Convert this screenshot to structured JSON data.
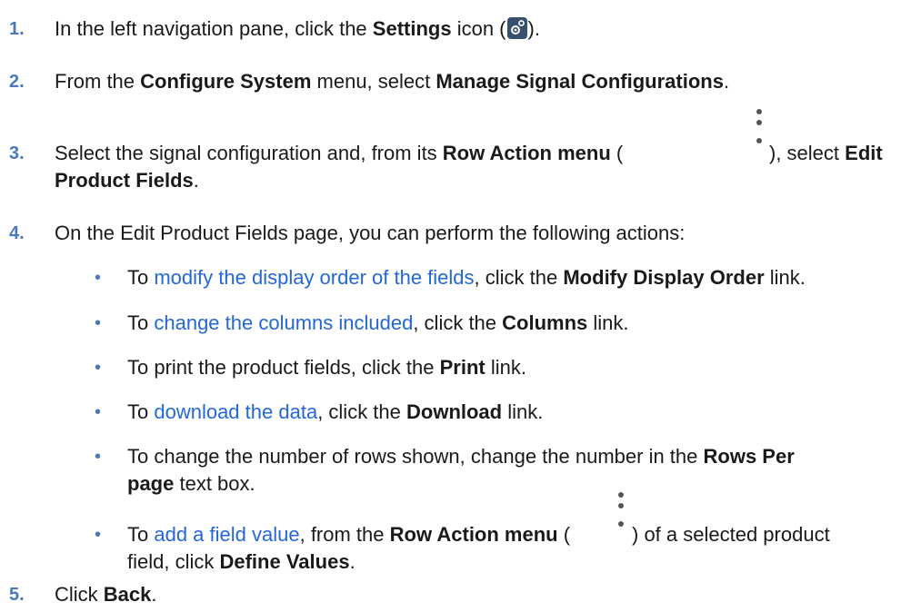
{
  "steps": [
    {
      "number": "1.",
      "before": "In the left navigation pane, click the ",
      "bold1": "Settings",
      "middle": " icon (",
      "after": ")."
    },
    {
      "number": "2.",
      "pre": "From the ",
      "bold1": "Configure System",
      "mid": " menu, select ",
      "bold2": "Manage Signal Configurations",
      "post": "."
    },
    {
      "number": "3.",
      "pre": "Select the signal configuration and, from its ",
      "bold1": "Row Action menu",
      "mid1": " (",
      "mid2": "), select ",
      "bold2a": "Edit",
      "bold2b": "Product Fields",
      "post": "."
    },
    {
      "number": "4.",
      "text": "On the Edit Product Fields page, you can perform the following actions:"
    },
    {
      "number": "5.",
      "pre": "Click ",
      "bold1": "Back",
      "post": "."
    }
  ],
  "bullets": [
    {
      "marker": "•",
      "pre": "To ",
      "link": "modify the display order of the fields",
      "mid": ", click the ",
      "bold": "Modify Display Order",
      "post": " link."
    },
    {
      "marker": "•",
      "pre": "To ",
      "link": "change the columns included",
      "mid": ", click the ",
      "bold": "Columns",
      "post": " link."
    },
    {
      "marker": "•",
      "pre": "To print the product fields, click the ",
      "bold": "Print",
      "post": " link."
    },
    {
      "marker": "•",
      "pre": "To ",
      "link": "download the data",
      "mid": ", click the ",
      "bold": "Download",
      "post": " link."
    },
    {
      "marker": "•",
      "pre": "To change the number of rows shown, change the number in the ",
      "bold1": "Rows Per",
      "bold2": "page",
      "post": " text box."
    },
    {
      "marker": "•",
      "pre": "To ",
      "link": "add a field value",
      "mid1": ", from the ",
      "bold1": "Row Action menu",
      "mid2": " (",
      "mid3": ") of a selected product",
      "line2pre": "field, click ",
      "bold2": "Define Values",
      "post": "."
    }
  ],
  "colors": {
    "number": "#4a78b8",
    "link": "#2467d6",
    "text": "#1a1a1a",
    "settings_icon": "#36506e"
  },
  "icons": {
    "settings": "gear-icon",
    "row_action": "kebab-icon"
  }
}
